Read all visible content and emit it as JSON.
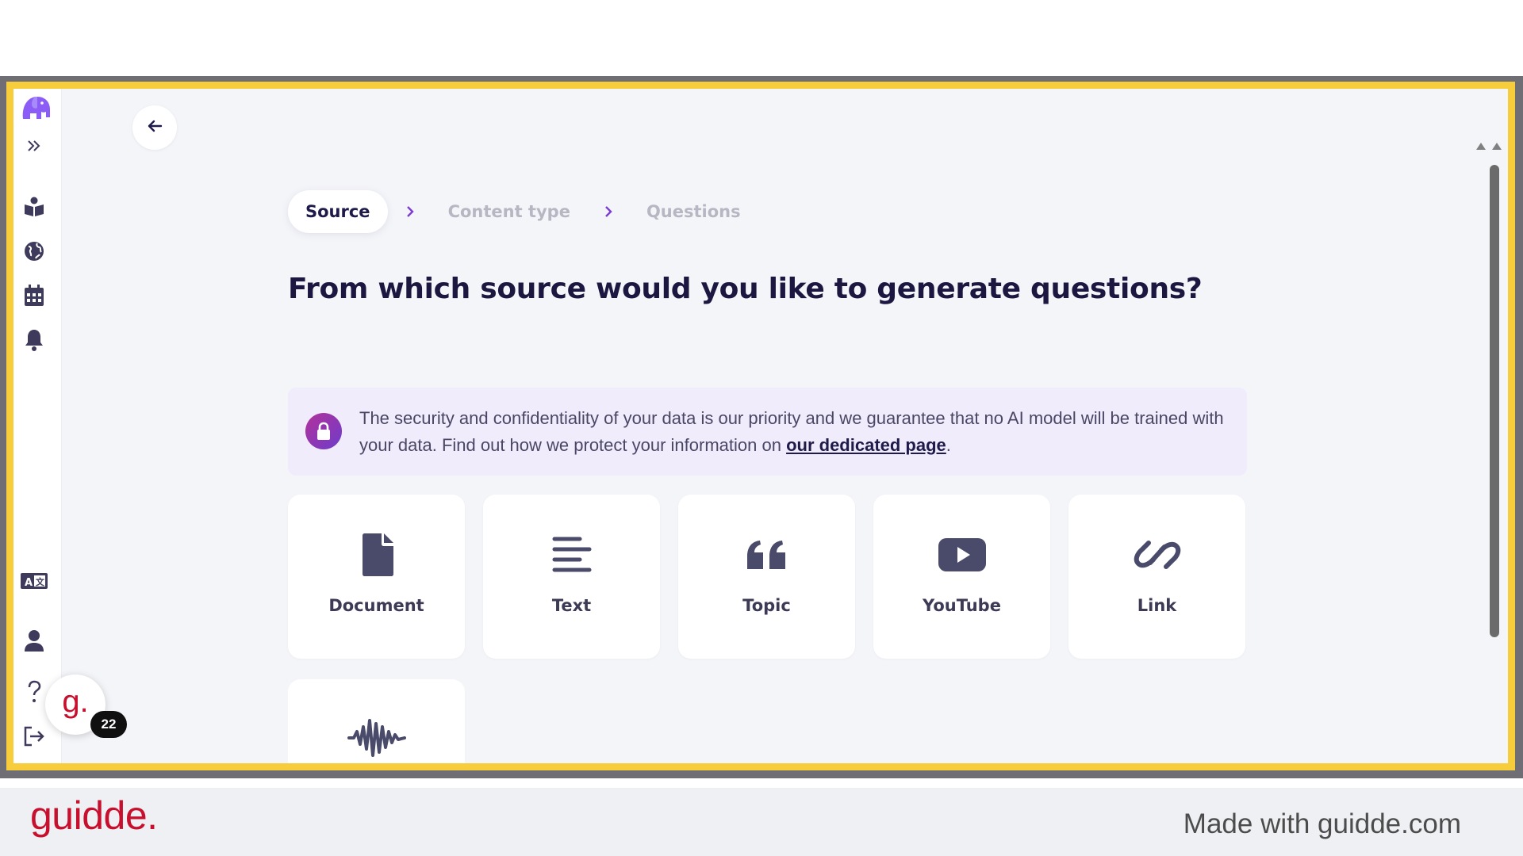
{
  "stepper": {
    "steps": [
      "Source",
      "Content type",
      "Questions"
    ],
    "active_index": 0
  },
  "main": {
    "heading": "From which source would you like to generate questions?"
  },
  "notice": {
    "text": "The security and confidentiality of your data is our priority and we guarantee that no AI model will be trained with your data. Find out how we protect your information on ",
    "link_text": "our dedicated page",
    "suffix": "."
  },
  "sources": [
    {
      "label": "Document",
      "icon": "document-icon"
    },
    {
      "label": "Text",
      "icon": "text-lines-icon"
    },
    {
      "label": "Topic",
      "icon": "quote-icon"
    },
    {
      "label": "YouTube",
      "icon": "youtube-icon"
    },
    {
      "label": "Link",
      "icon": "link-icon"
    },
    {
      "label": "",
      "icon": "audio-wave-icon"
    }
  ],
  "sidebar": {
    "icons": [
      "elephant-logo-icon",
      "expand-icon",
      "library-icon",
      "globe-icon",
      "calendar-icon",
      "bell-icon",
      "language-icon",
      "user-icon",
      "help-icon",
      "logout-icon"
    ]
  },
  "guidde_badge": {
    "letter": "g.",
    "count": "22"
  },
  "footer": {
    "logo": "guidde.",
    "made_with": "Made with guidde.com"
  },
  "colors": {
    "frame_border": "#f8cd3c",
    "accent_purple": "#7d3ccf",
    "text_dark": "#1b1740",
    "brand_red": "#c8102e"
  }
}
